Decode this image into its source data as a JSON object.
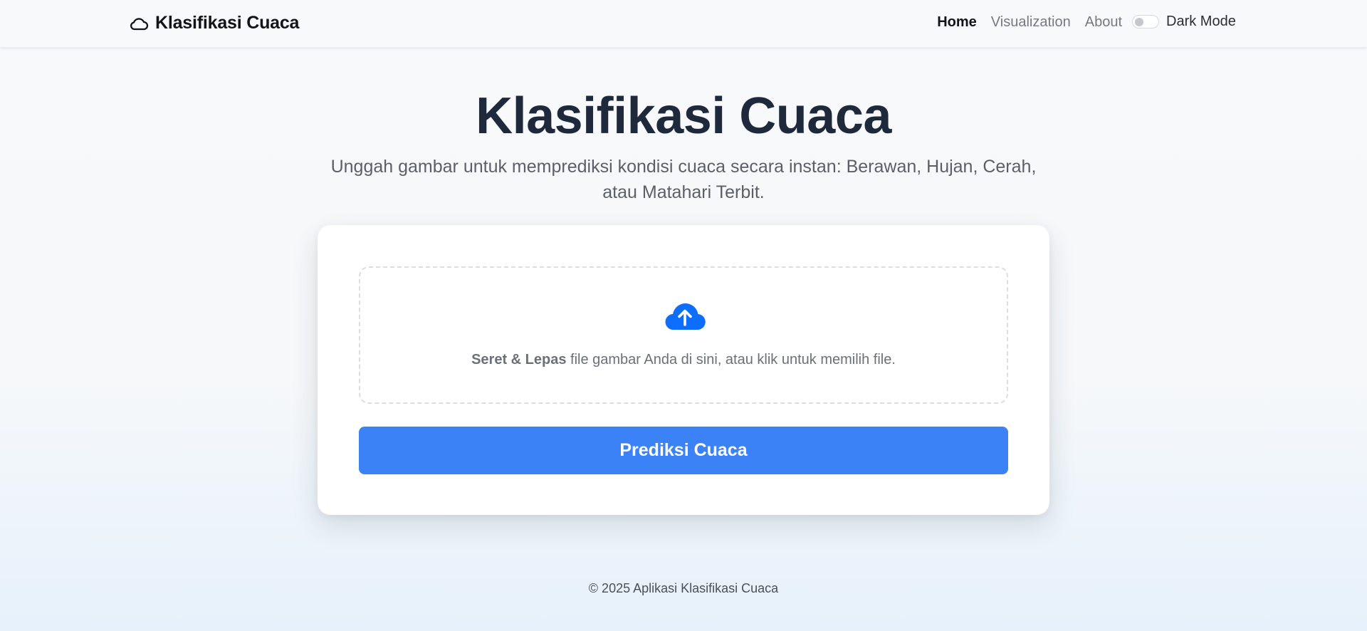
{
  "navbar": {
    "brand_icon": "cloud-icon",
    "brand_title": "Klasifikasi Cuaca",
    "links": [
      "Home",
      "Visualization",
      "About"
    ],
    "active_link": "Home",
    "dark_mode_label": "Dark Mode",
    "dark_mode_on": false
  },
  "hero": {
    "title": "Klasifikasi Cuaca",
    "subtitle": "Unggah gambar untuk memprediksi kondisi cuaca secara instan: Berawan, Hujan, Cerah, atau Matahari Terbit."
  },
  "upload": {
    "icon": "cloud-upload-icon",
    "bold_text": "Seret & Lepas",
    "text": " file gambar Anda di sini, atau klik untuk memilih file."
  },
  "predict_button": "Prediksi Cuaca",
  "footer": "© 2025 Aplikasi Klasifikasi Cuaca",
  "colors": {
    "accent": "#3b82f6",
    "icon_blue": "#0d6efd",
    "title": "#1e293b"
  }
}
